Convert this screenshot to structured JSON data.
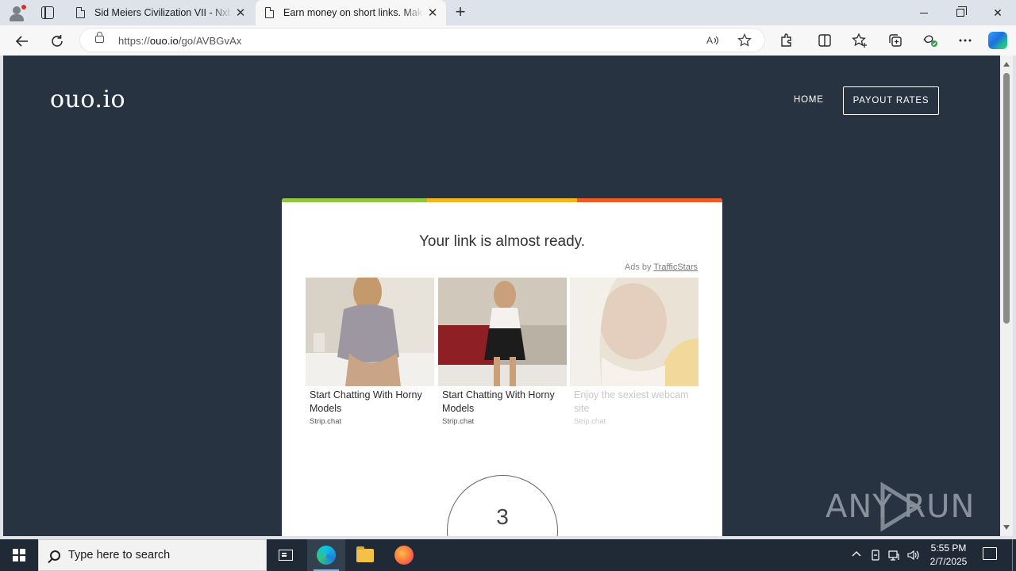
{
  "browser": {
    "tabs": [
      {
        "title": "Sid Meiers Civilization VII - Nxbre",
        "active": false
      },
      {
        "title": "Earn money on short links. Make",
        "active": true
      }
    ],
    "url_prefix": "https://",
    "url_domain": "ouo.io",
    "url_path": "/go/AVBGvAx",
    "new_tab_symbol": "+",
    "close_symbol": "✕"
  },
  "site": {
    "logo": "ouo.io",
    "nav": {
      "home": "HOME",
      "payout": "PAYOUT RATES"
    },
    "card_title": "Your link is almost ready.",
    "ads_by_prefix": "Ads by ",
    "ads_by_link": "TrafficStars",
    "ads": [
      {
        "caption": "Start Chatting With Horny Models",
        "source": "Strip.chat"
      },
      {
        "caption": "Start Chatting With Horny Models",
        "source": "Strip.chat"
      },
      {
        "caption": "Enjoy the sexiest webcam site",
        "source": "Strip.chat"
      }
    ],
    "countdown": "3",
    "stripe_colors": [
      "#8dc63f",
      "#f2b51c",
      "#f05a24"
    ]
  },
  "watermark": {
    "text": "ANY RUN"
  },
  "taskbar": {
    "search_placeholder": "Type here to search",
    "time": "5:55 PM",
    "date": "2/7/2025"
  },
  "colors": {
    "page_bg": "#273340",
    "card_bg": "#ffffff",
    "taskbar_bg": "#1f2a36"
  }
}
